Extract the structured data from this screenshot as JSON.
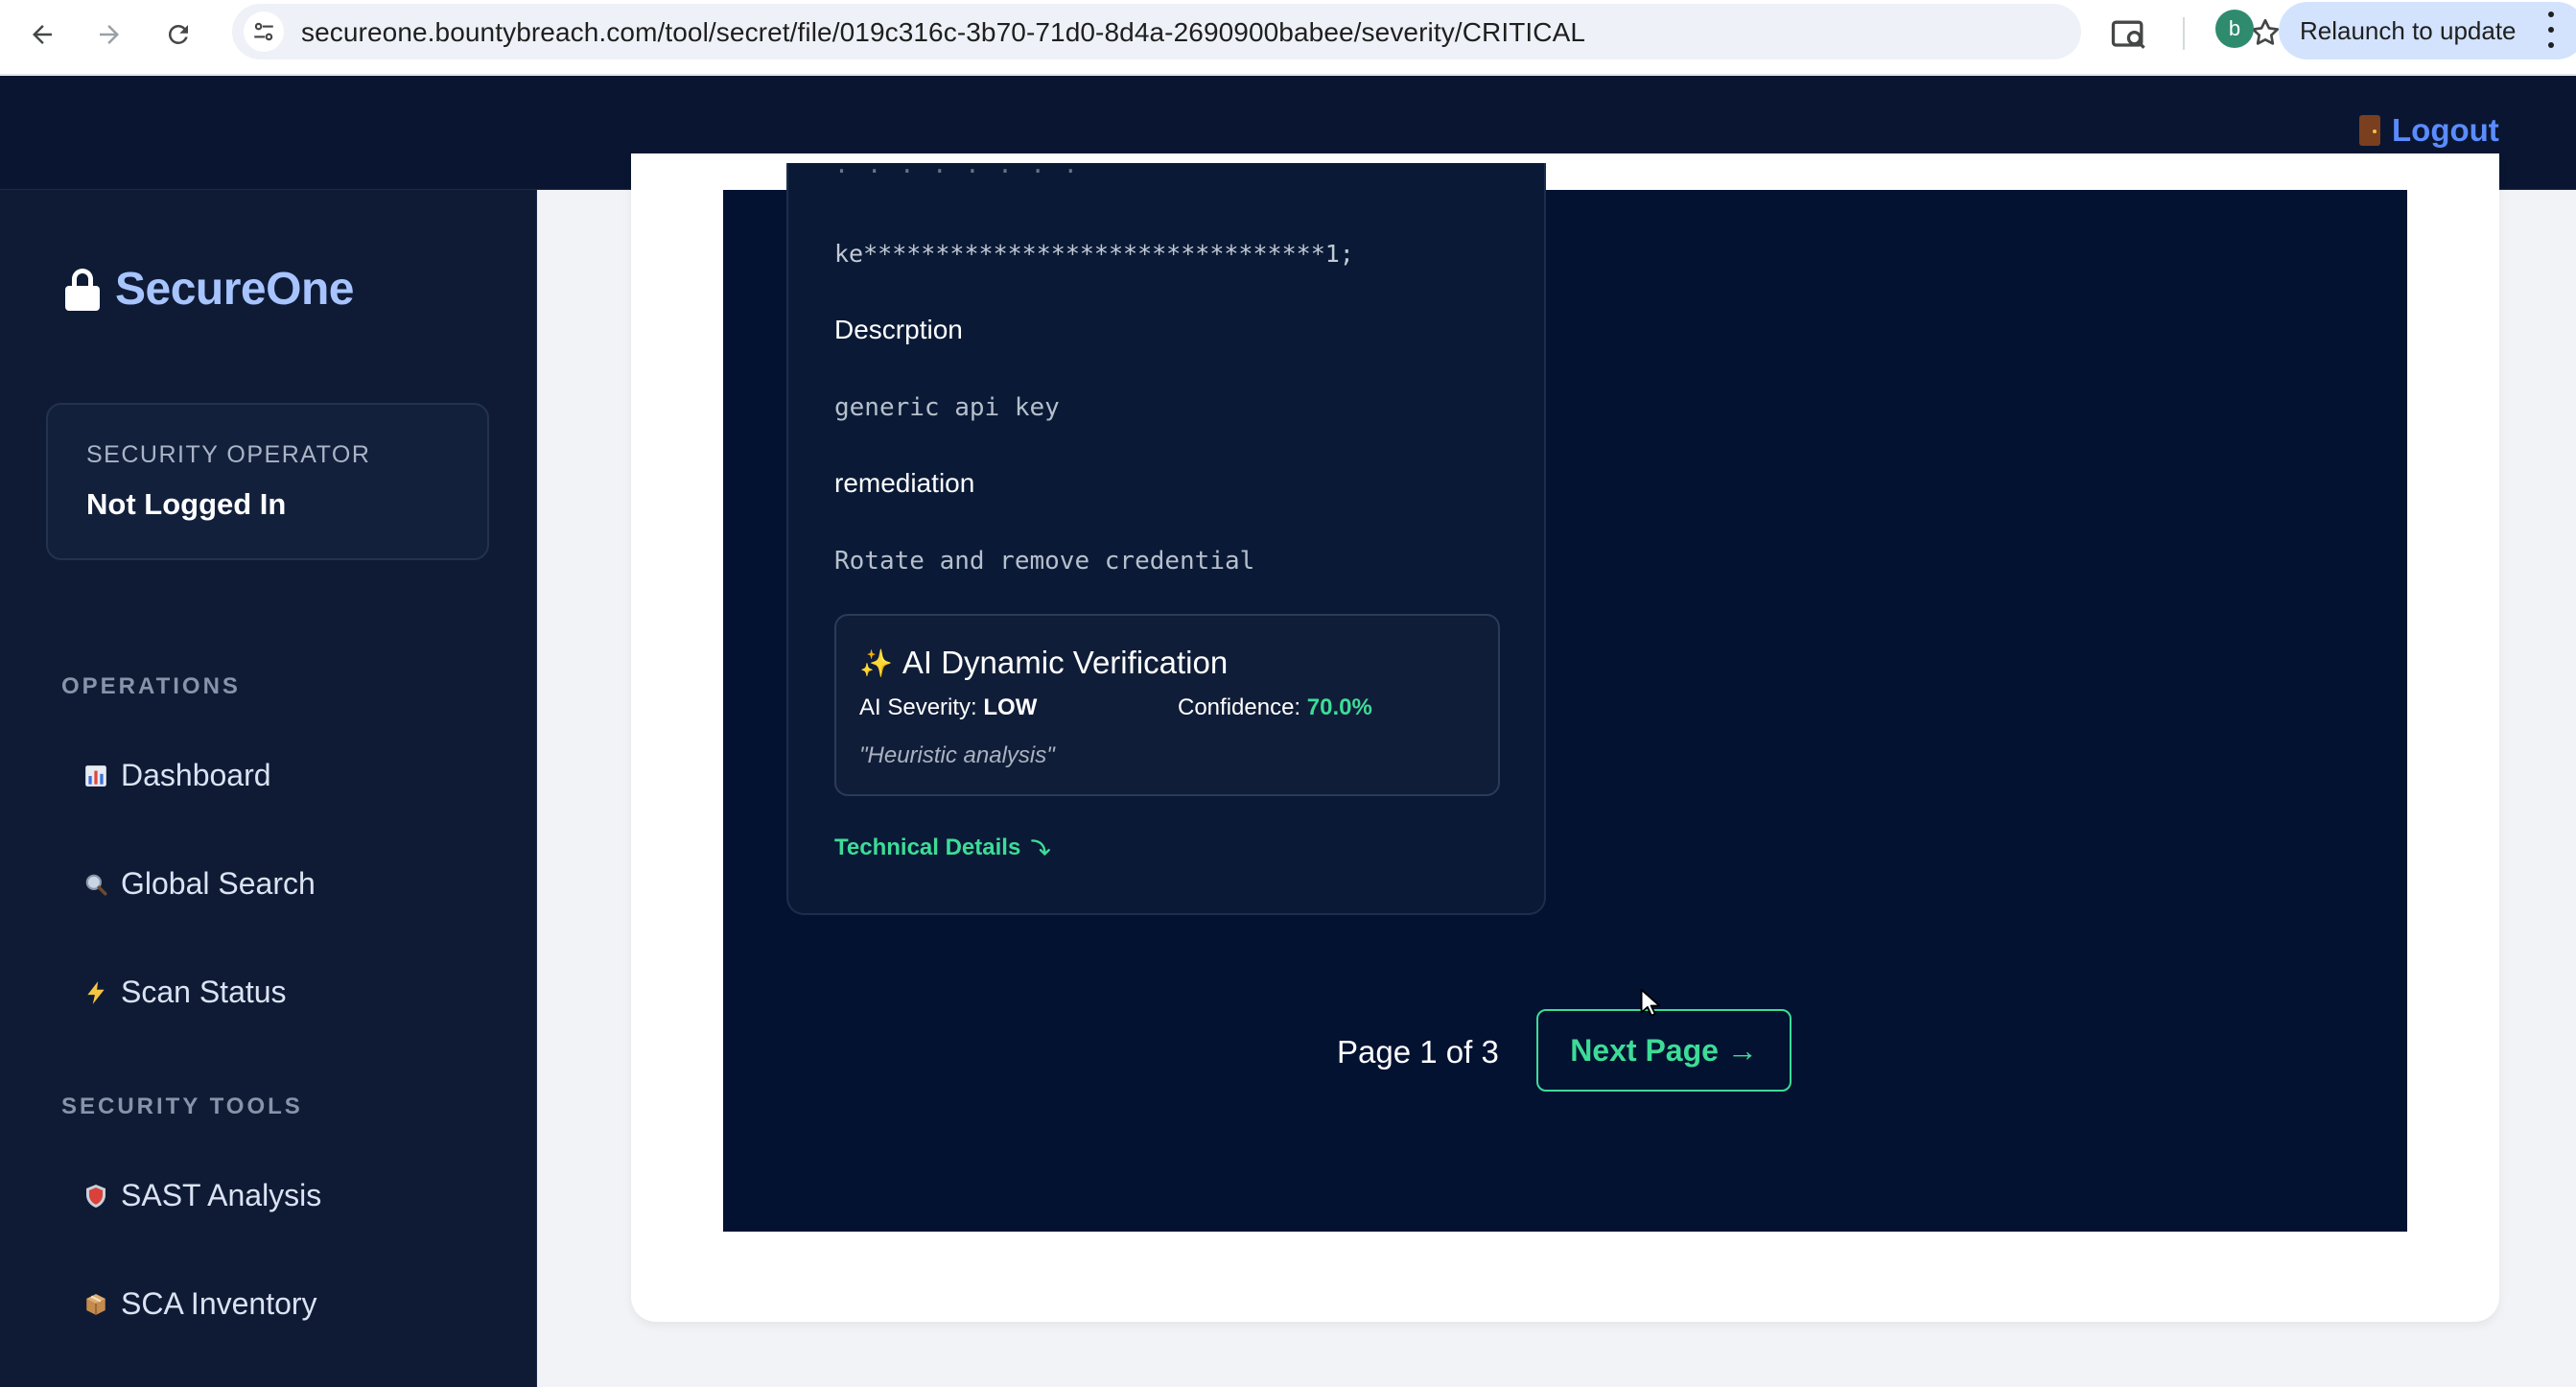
{
  "browser": {
    "url": "secureone.bountybreach.com/tool/secret/file/019c316c-3b70-71d0-8d4a-2690900babee/severity/CRITICAL",
    "profile_initial": "b",
    "relaunch_label": "Relaunch to update",
    "icons": [
      "back-arrow-icon",
      "forward-arrow-icon",
      "reload-icon",
      "site-info-icon",
      "star-icon",
      "zoom-lens-icon",
      "kebab-menu-icon"
    ]
  },
  "header": {
    "logout_label": "Logout",
    "logout_icon": "door-icon",
    "accent_color": "#5b8cff"
  },
  "sidebar": {
    "brand": "SecureOne",
    "brand_icon": "lock-icon",
    "operator_label": "SECURITY OPERATOR",
    "operator_value": "Not Logged In",
    "sections": [
      {
        "label": "OPERATIONS",
        "items": [
          {
            "icon": "bar-chart-icon",
            "label": "Dashboard"
          },
          {
            "icon": "magnifier-icon",
            "label": "Global Search"
          },
          {
            "icon": "lightning-icon",
            "label": "Scan Status"
          }
        ]
      },
      {
        "label": "SECURITY TOOLS",
        "items": [
          {
            "icon": "shield-icon",
            "label": "SAST Analysis"
          },
          {
            "icon": "package-icon",
            "label": "SCA Inventory"
          }
        ]
      }
    ]
  },
  "finding": {
    "masked_key": "ke********************************1;",
    "description_heading": "Descrption",
    "description_value": "generic api key",
    "remediation_heading": "remediation",
    "remediation_value": "Rotate and remove credential",
    "ai": {
      "title": "AI Dynamic Verification",
      "icon": "sparkles-icon",
      "severity_label": "AI Severity:",
      "severity_value": "LOW",
      "confidence_label": "Confidence:",
      "confidence_value": "70.0%",
      "note": "\"Heuristic analysis\""
    },
    "technical_details_label": "Technical Details"
  },
  "pagination": {
    "page_label": "Page 1 of 3",
    "next_label": "Next Page →"
  },
  "colors": {
    "header_bg": "#0a1631",
    "sidebar_bg": "#0f1b35",
    "panel_bg": "#041232",
    "success": "#3ddc97"
  }
}
